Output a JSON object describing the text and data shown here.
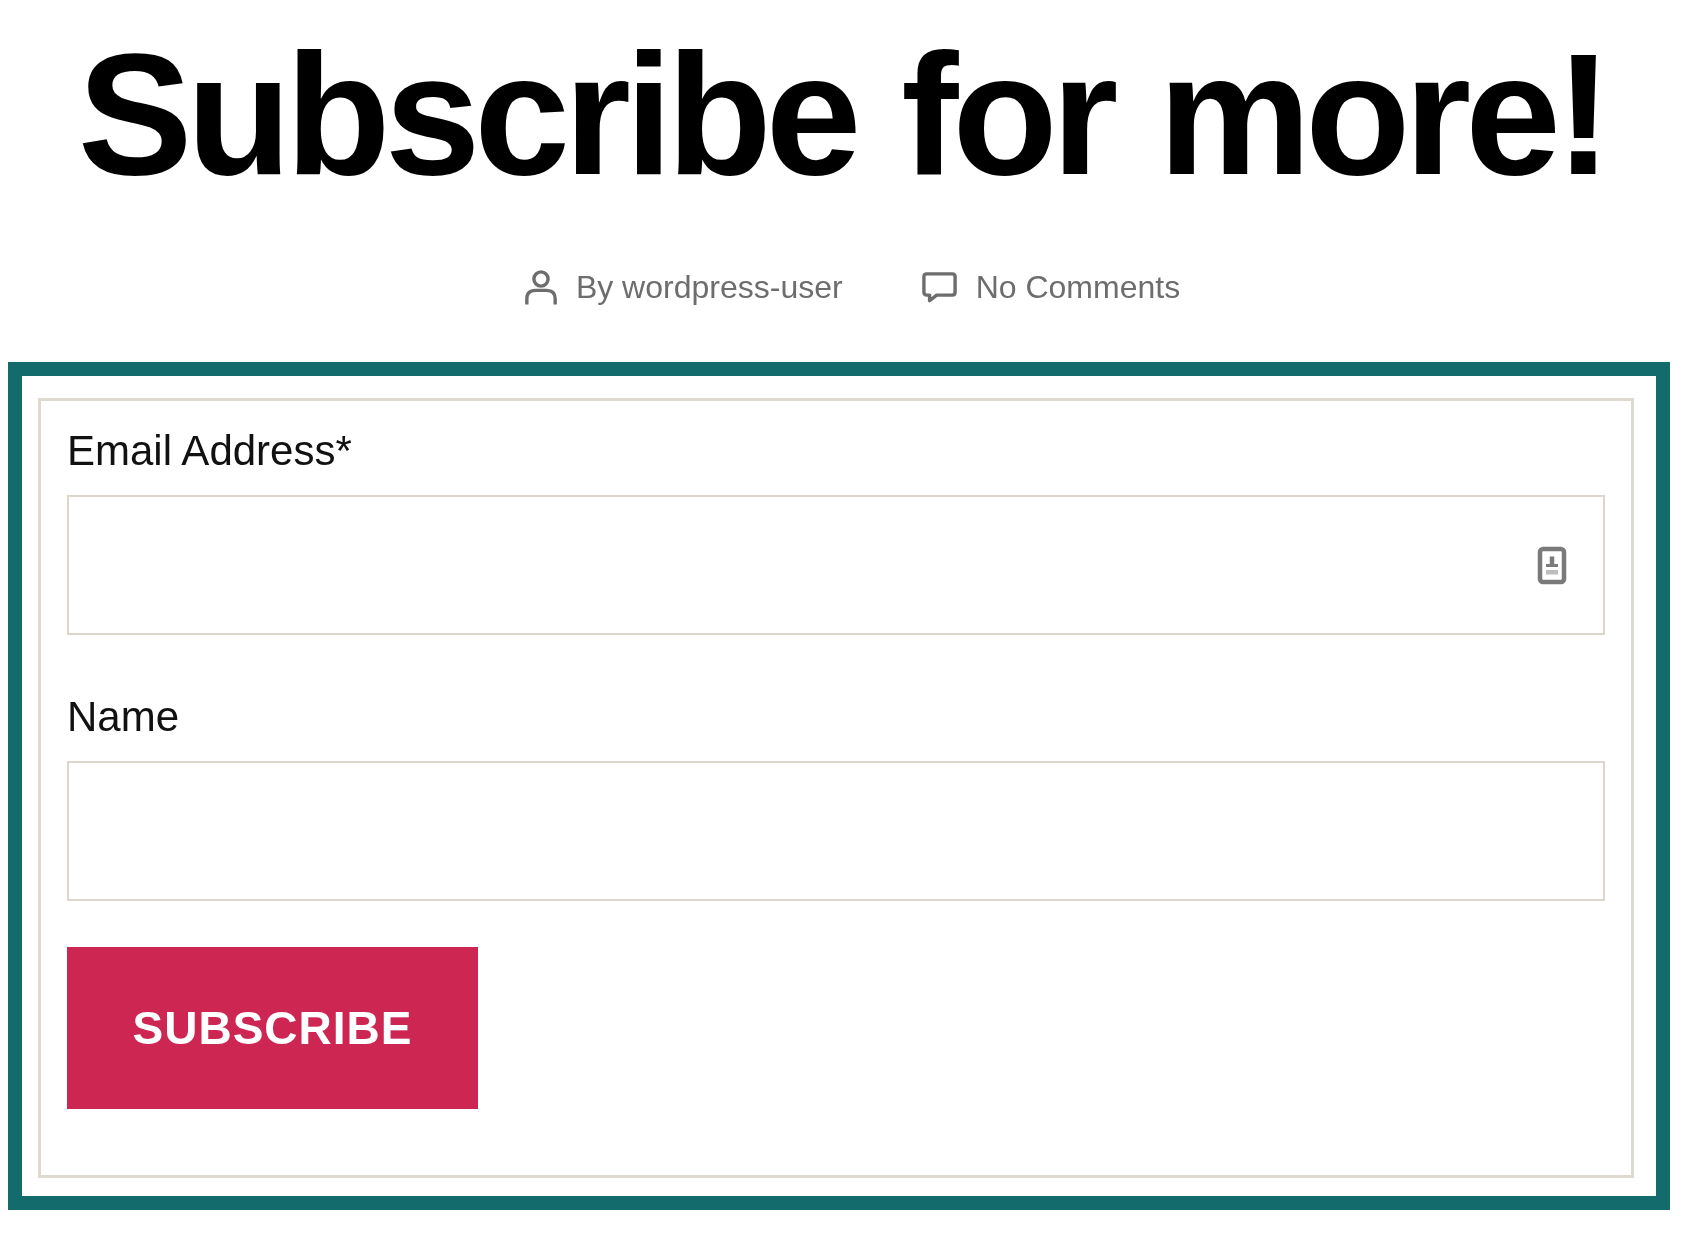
{
  "title": "Subscribe for more!",
  "meta": [
    {
      "kind": "author",
      "text": "By wordpress-user"
    },
    {
      "kind": "comments",
      "text": "No Comments"
    }
  ],
  "form": {
    "fields": [
      {
        "kind": "email",
        "label": "Email Address*"
      },
      {
        "kind": "text",
        "label": "Name"
      }
    ],
    "button": "SUBSCRIBE"
  }
}
